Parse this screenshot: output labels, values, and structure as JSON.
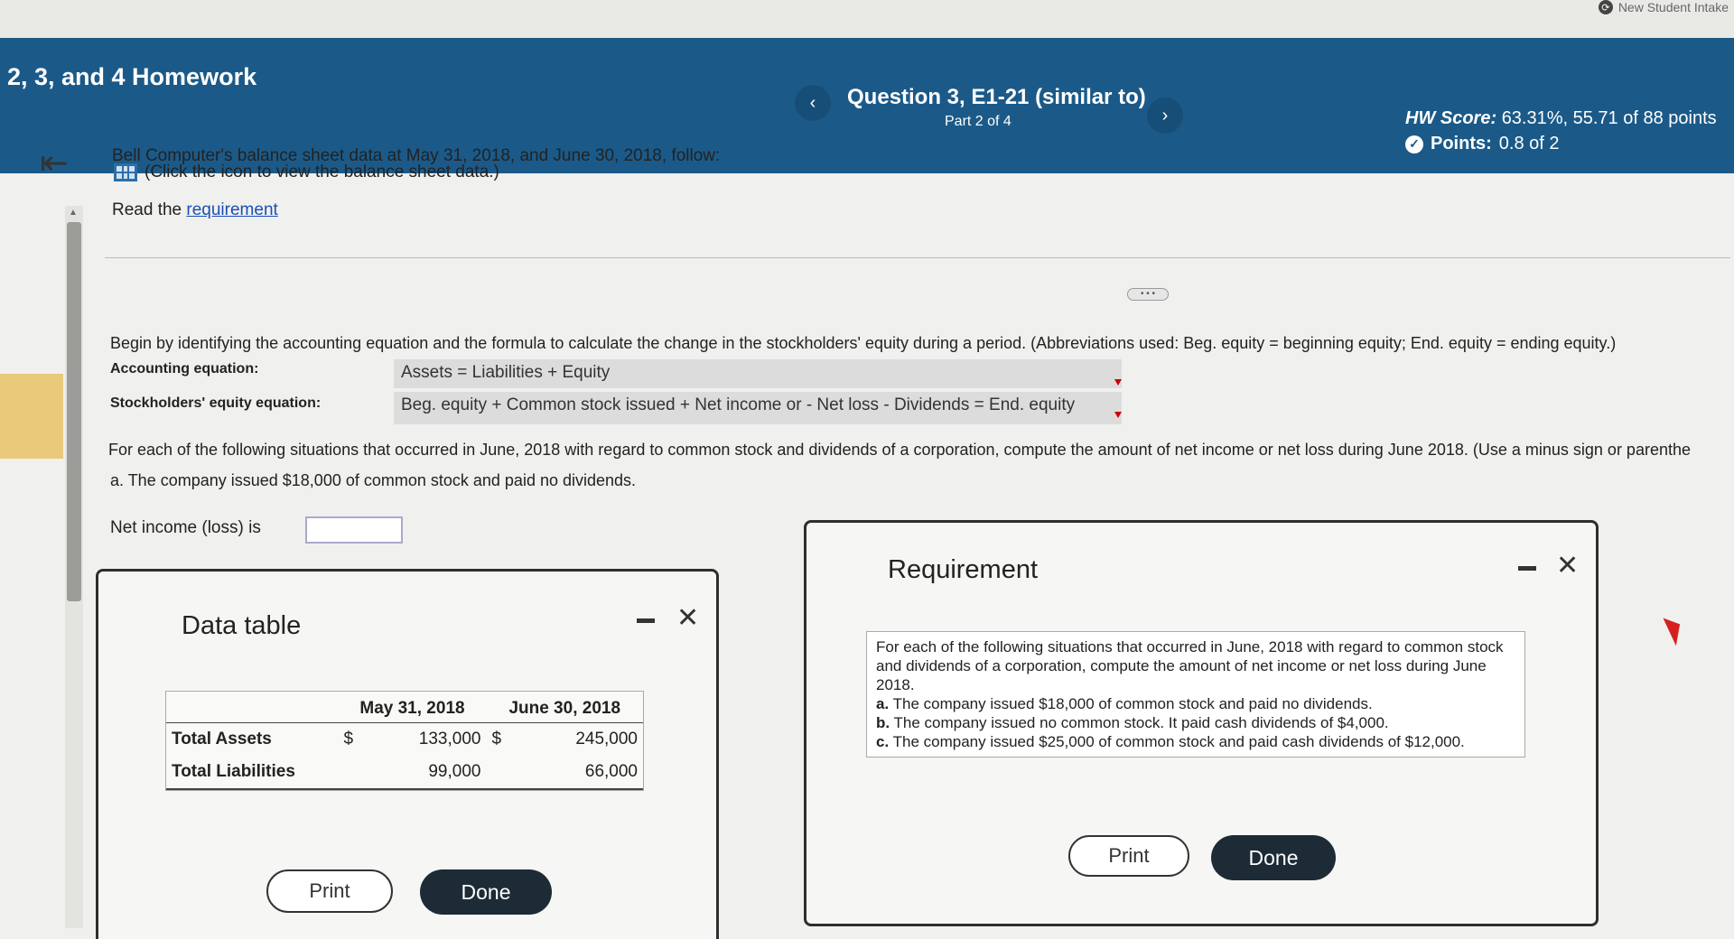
{
  "topbar": {
    "intake_label": "New Student Intake"
  },
  "header": {
    "assignment_title": "2, 3, and 4 Homework",
    "question_title": "Question 3, E1-21 (similar to)",
    "question_part": "Part 2 of 4",
    "prev_label": "‹",
    "next_label": "›",
    "hw_score_label": "HW Score:",
    "hw_score_value": "63.31%, 55.71 of 88 points",
    "points_label": "Points:",
    "points_value": "0.8 of 2"
  },
  "question": {
    "intro": "Bell Computer's balance sheet data at May 31, 2018, and June 30, 2018, follow:",
    "icon_hint": "(Click the icon to view the balance sheet data.)",
    "read_the": "Read the",
    "requirement_link": "requirement",
    "more_label": "• • •",
    "instruction": "Begin by identifying the accounting equation and the formula to calculate the change in the stockholders' equity during a period. (Abbreviations used: Beg. equity = beginning equity; End. equity = ending equity.)",
    "accounting_eq_label": "Accounting equation:",
    "accounting_eq_value": "Assets = Liabilities + Equity",
    "se_eq_label": "Stockholders' equity equation:",
    "se_eq_value": "Beg. equity + Common stock issued + Net income or - Net loss - Dividends = End. equity",
    "situations": "For each of the following situations that occurred in June, 2018 with regard to common stock and dividends of a corporation, compute the amount of net income or net loss during June 2018. (Use a minus sign or parenthe",
    "part_a": "a. The company issued $18,000 of common stock and paid no dividends.",
    "answer_label": "Net income (loss) is",
    "answer_value": ""
  },
  "data_table": {
    "title": "Data table",
    "columns": [
      "",
      "May 31, 2018",
      "June 30, 2018"
    ],
    "rows": [
      {
        "label": "Total Assets",
        "sym1": "$",
        "may": "133,000",
        "sym2": "$",
        "june": "245,000"
      },
      {
        "label": "Total Liabilities",
        "sym1": "",
        "may": "99,000",
        "sym2": "",
        "june": "66,000"
      }
    ],
    "print_label": "Print",
    "done_label": "Done"
  },
  "requirement_dialog": {
    "title": "Requirement",
    "intro": "For each of the following situations that occurred in June, 2018 with regard to common stock and dividends of a corporation, compute the amount of net income or net loss during June 2018.",
    "items": [
      {
        "letter": "a.",
        "text": "The company issued $18,000 of common stock and paid no dividends."
      },
      {
        "letter": "b.",
        "text": "The company issued no common stock. It paid cash dividends of $4,000."
      },
      {
        "letter": "c.",
        "text": "The company issued $25,000 of common stock and paid cash dividends of $12,000."
      }
    ],
    "print_label": "Print",
    "done_label": "Done"
  }
}
